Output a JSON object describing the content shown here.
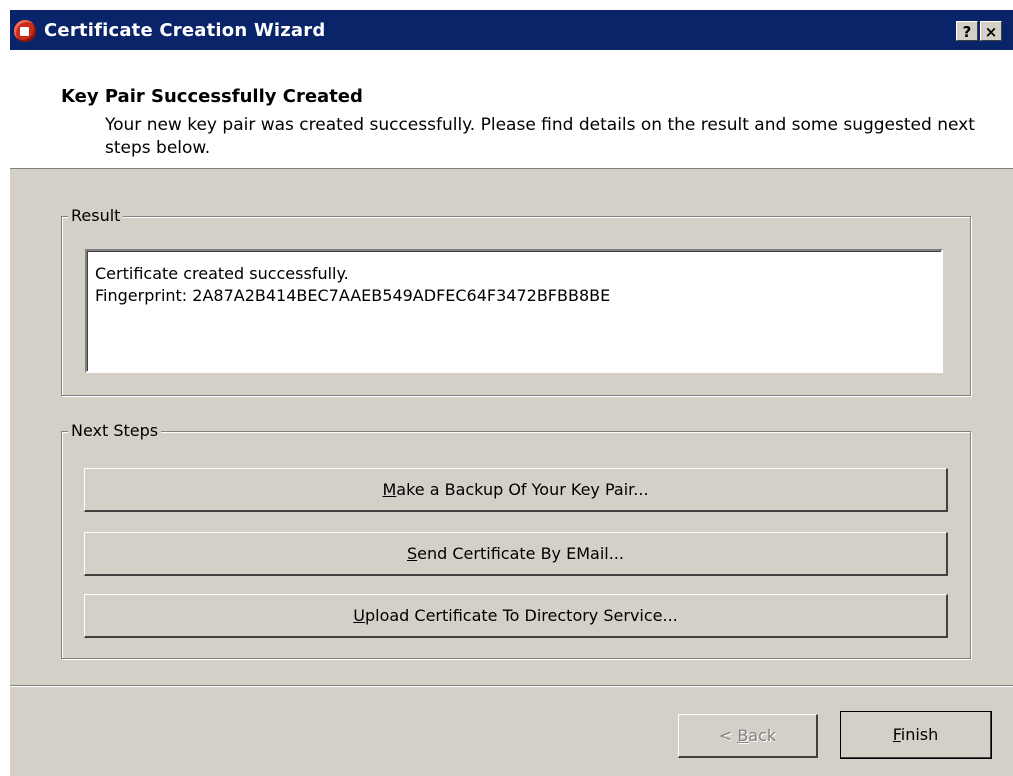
{
  "window": {
    "title": "Certificate Creation Wizard",
    "help_label": "?",
    "close_label": "×",
    "icon": "app-icon"
  },
  "header": {
    "title": "Key Pair Successfully Created",
    "subtitle": "Your new key pair was created successfully. Please find details on the result and some suggested next steps below."
  },
  "result": {
    "legend": "Result",
    "line1": "Certificate created successfully.",
    "line2": "Fingerprint: 2A87A2B414BEC7AAEB549ADFEC64F3472BFBB8BE"
  },
  "next_steps": {
    "legend": "Next Steps",
    "backup": {
      "mnemonic": "M",
      "rest": "ake a Backup Of Your Key Pair..."
    },
    "email": {
      "mnemonic": "S",
      "rest": "end Certificate By EMail..."
    },
    "upload": {
      "mnemonic": "U",
      "rest": "pload Certificate To Directory Service..."
    }
  },
  "footer": {
    "back": {
      "prefix": "< ",
      "mnemonic": "B",
      "rest": "ack",
      "enabled": false
    },
    "finish": {
      "mnemonic": "F",
      "rest": "inish"
    }
  },
  "colors": {
    "titlebar": "#0a246a",
    "dialog_bg": "#d4d0c8",
    "icon_red": "#cc2b1a"
  }
}
